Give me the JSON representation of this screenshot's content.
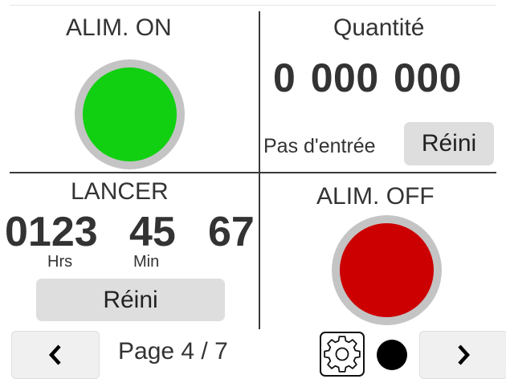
{
  "panels": {
    "power_on": {
      "title": "ALIM. ON",
      "lamp_color": "#11d011"
    },
    "quantity": {
      "title": "Quantité",
      "value": "0 000 000",
      "step_label": "Pas d'entrée",
      "reset_label": "Réini"
    },
    "run_timer": {
      "title": "LANCER",
      "hours": "0123",
      "minutes": "45",
      "seconds": "67",
      "hours_unit": "Hrs",
      "minutes_unit": "Min",
      "reset_label": "Réini"
    },
    "power_off": {
      "title": "ALIM. OFF",
      "lamp_color": "#cc0000"
    }
  },
  "footer": {
    "page_label": "Page 4 / 7",
    "prev_icon": "chevron-left-icon",
    "next_icon": "chevron-right-icon",
    "settings_icon": "gear-icon",
    "status_dot_color": "#000000"
  }
}
